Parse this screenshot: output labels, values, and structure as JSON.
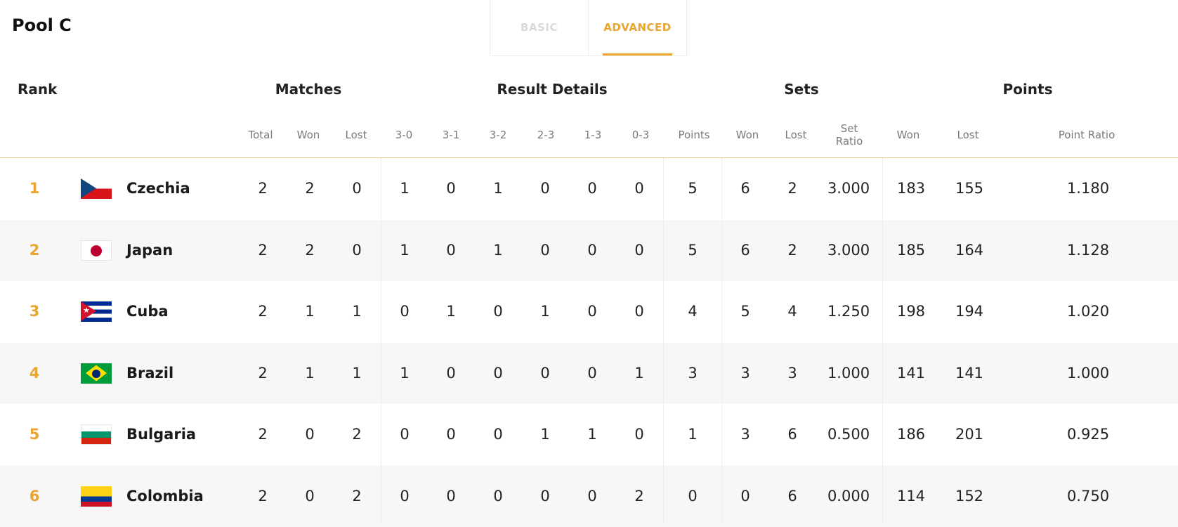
{
  "title": "Pool C",
  "tabs": [
    {
      "label": "BASIC",
      "active": false
    },
    {
      "label": "ADVANCED",
      "active": true
    }
  ],
  "groups": {
    "rank": "Rank",
    "matches": "Matches",
    "result_details": "Result Details",
    "sets": "Sets",
    "points": "Points"
  },
  "columns": {
    "total": "Total",
    "won": "Won",
    "lost": "Lost",
    "r30": "3-0",
    "r31": "3-1",
    "r32": "3-2",
    "r23": "2-3",
    "r13": "1-3",
    "r03": "0-3",
    "points": "Points",
    "sets_won": "Won",
    "sets_lost": "Lost",
    "set_ratio_1": "Set",
    "set_ratio_2": "Ratio",
    "pts_won": "Won",
    "pts_lost": "Lost",
    "point_ratio": "Point Ratio"
  },
  "rows": [
    {
      "rank": "1",
      "flag": "cz-flag-icon",
      "team": "Czechia",
      "total": "2",
      "won": "2",
      "lost": "0",
      "r30": "1",
      "r31": "0",
      "r32": "1",
      "r23": "0",
      "r13": "0",
      "r03": "0",
      "points": "5",
      "sets_won": "6",
      "sets_lost": "2",
      "set_ratio": "3.000",
      "pts_won": "183",
      "pts_lost": "155",
      "point_ratio": "1.180"
    },
    {
      "rank": "2",
      "flag": "jp-flag-icon",
      "team": "Japan",
      "total": "2",
      "won": "2",
      "lost": "0",
      "r30": "1",
      "r31": "0",
      "r32": "1",
      "r23": "0",
      "r13": "0",
      "r03": "0",
      "points": "5",
      "sets_won": "6",
      "sets_lost": "2",
      "set_ratio": "3.000",
      "pts_won": "185",
      "pts_lost": "164",
      "point_ratio": "1.128"
    },
    {
      "rank": "3",
      "flag": "cu-flag-icon",
      "team": "Cuba",
      "total": "2",
      "won": "1",
      "lost": "1",
      "r30": "0",
      "r31": "1",
      "r32": "0",
      "r23": "1",
      "r13": "0",
      "r03": "0",
      "points": "4",
      "sets_won": "5",
      "sets_lost": "4",
      "set_ratio": "1.250",
      "pts_won": "198",
      "pts_lost": "194",
      "point_ratio": "1.020"
    },
    {
      "rank": "4",
      "flag": "br-flag-icon",
      "team": "Brazil",
      "total": "2",
      "won": "1",
      "lost": "1",
      "r30": "1",
      "r31": "0",
      "r32": "0",
      "r23": "0",
      "r13": "0",
      "r03": "1",
      "points": "3",
      "sets_won": "3",
      "sets_lost": "3",
      "set_ratio": "1.000",
      "pts_won": "141",
      "pts_lost": "141",
      "point_ratio": "1.000"
    },
    {
      "rank": "5",
      "flag": "bg-flag-icon",
      "team": "Bulgaria",
      "total": "2",
      "won": "0",
      "lost": "2",
      "r30": "0",
      "r31": "0",
      "r32": "0",
      "r23": "1",
      "r13": "1",
      "r03": "0",
      "points": "1",
      "sets_won": "3",
      "sets_lost": "6",
      "set_ratio": "0.500",
      "pts_won": "186",
      "pts_lost": "201",
      "point_ratio": "0.925"
    },
    {
      "rank": "6",
      "flag": "co-flag-icon",
      "team": "Colombia",
      "total": "2",
      "won": "0",
      "lost": "2",
      "r30": "0",
      "r31": "0",
      "r32": "0",
      "r23": "0",
      "r13": "0",
      "r03": "2",
      "points": "0",
      "sets_won": "0",
      "sets_lost": "6",
      "set_ratio": "0.000",
      "pts_won": "114",
      "pts_lost": "152",
      "point_ratio": "0.750"
    }
  ],
  "colors": {
    "accent": "#e8a530",
    "header_rule": "#e2c98d",
    "row_alt": "#f7f7f7"
  }
}
